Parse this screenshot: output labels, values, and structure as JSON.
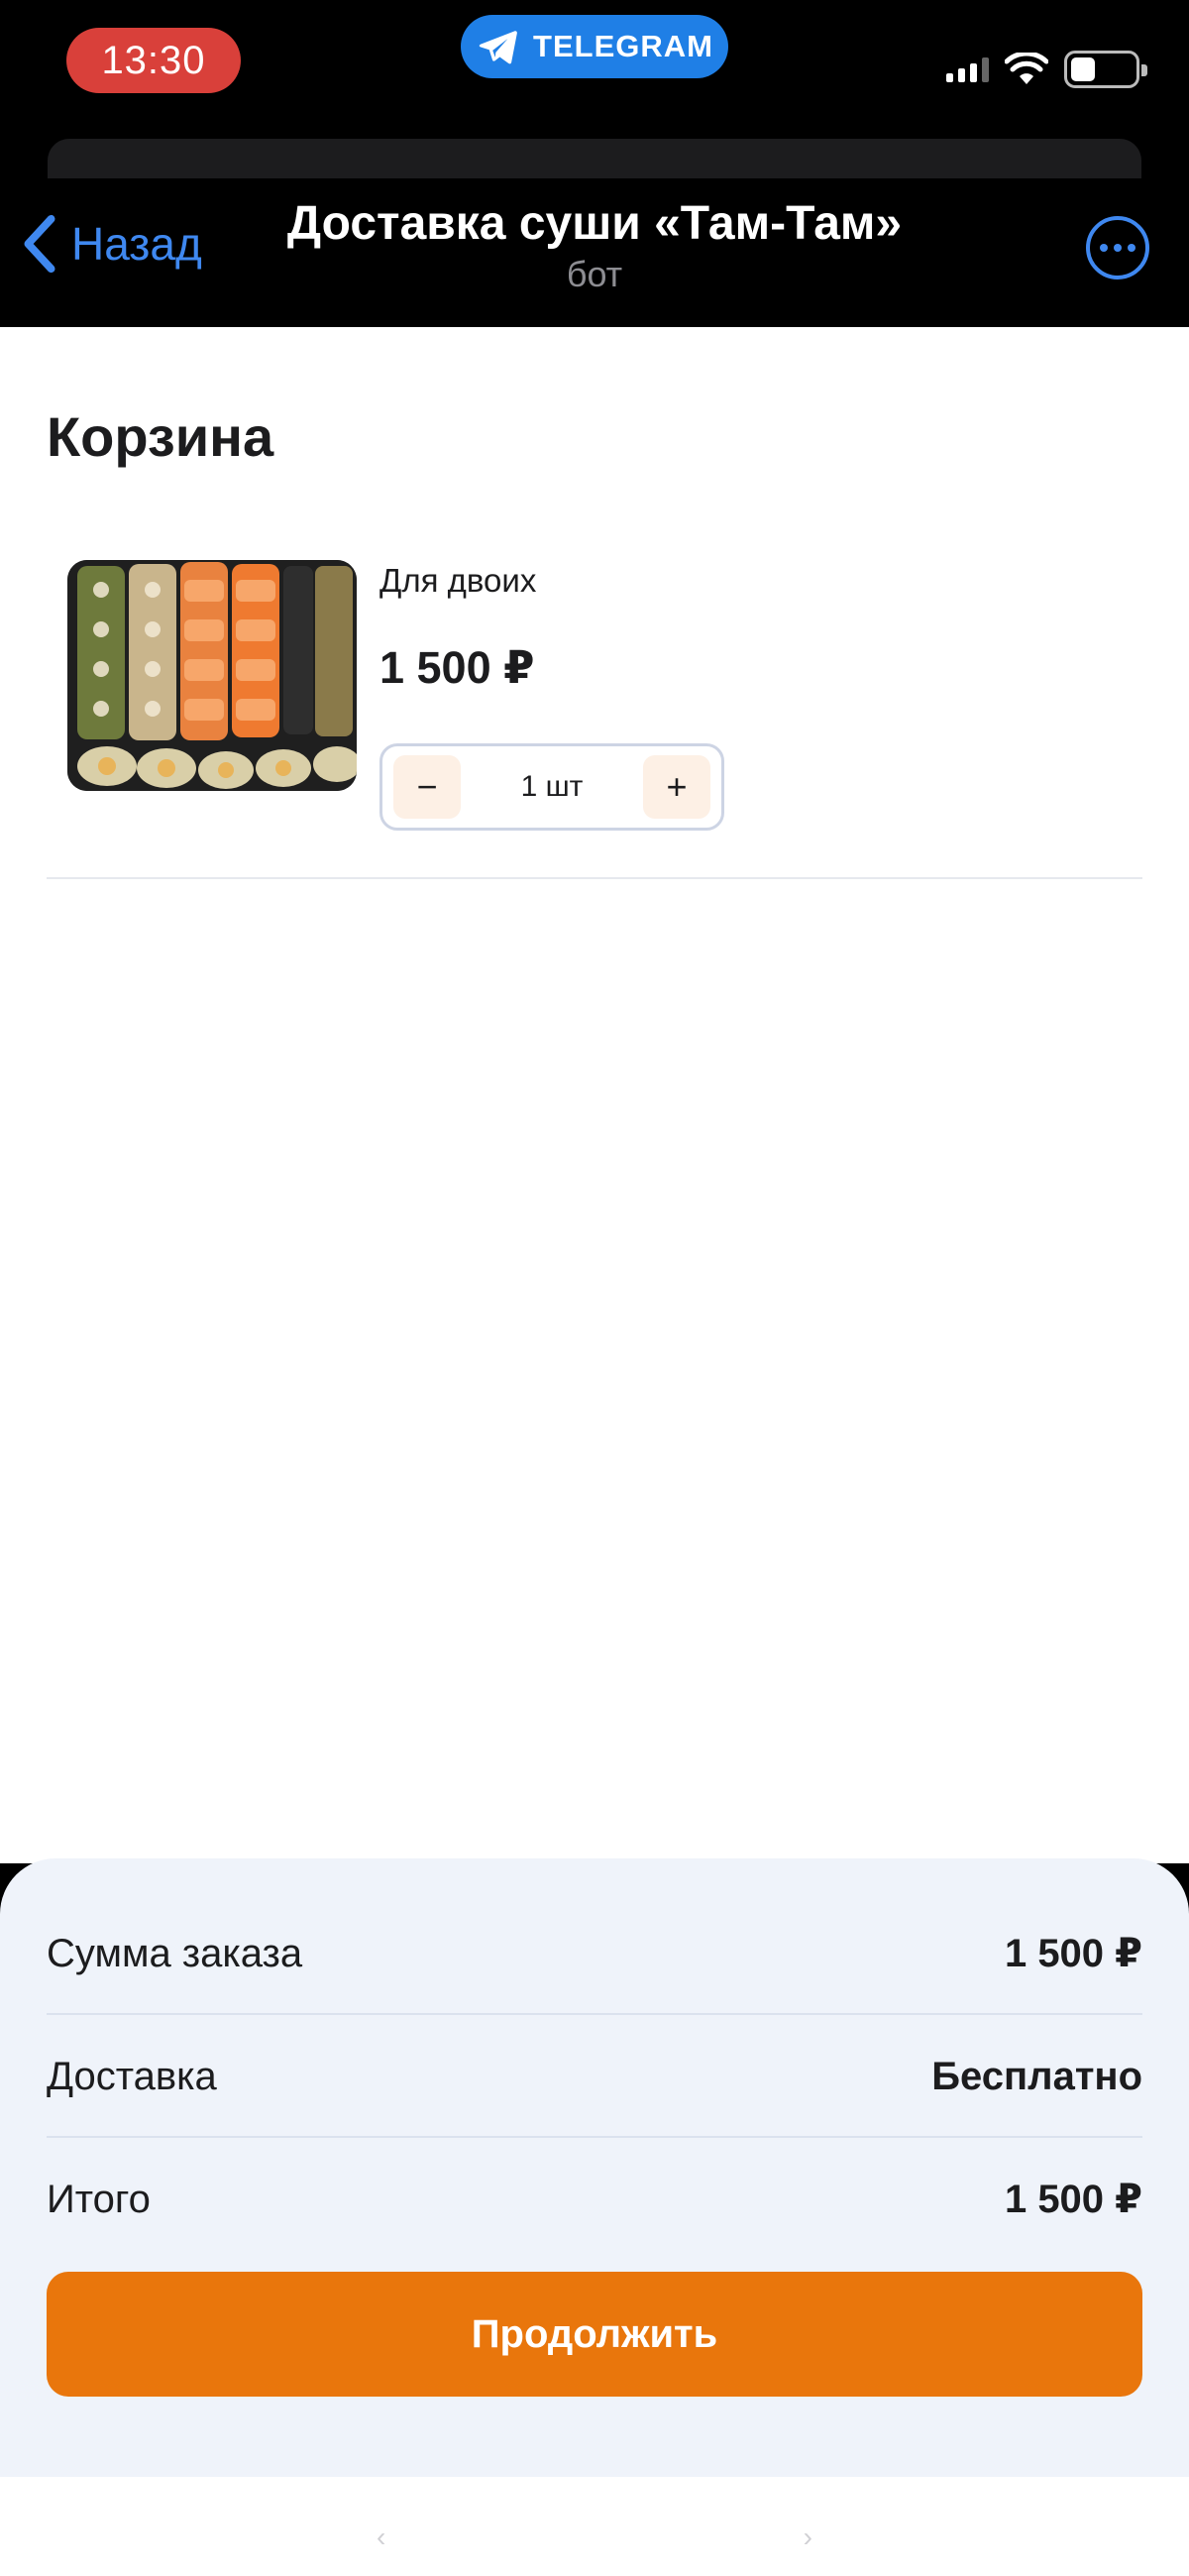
{
  "status_bar": {
    "time": "13:30",
    "app_badge": "TELEGRAM",
    "icons": [
      "signal-icon",
      "wifi-icon",
      "battery-icon"
    ]
  },
  "header": {
    "back_label": "Назад",
    "title": "Доставка суши «Там-Там»",
    "subtitle": "бот",
    "accent_color": "#3f88f0"
  },
  "cart": {
    "title": "Корзина",
    "items": [
      {
        "name": "Для двоих",
        "price": "1 500 ₽",
        "quantity_label": "1 шт",
        "minus_label": "−",
        "plus_label": "+"
      }
    ]
  },
  "summary": {
    "order_sum_label": "Сумма заказа",
    "order_sum_value": "1 500 ₽",
    "delivery_label": "Доставка",
    "delivery_value": "Бесплатно",
    "total_label": "Итого",
    "total_value": "1 500 ₽",
    "continue_label": "Продолжить",
    "button_color": "#e9760c"
  },
  "bottom_bar": {
    "prev_label": "‹",
    "next_label": "›"
  }
}
